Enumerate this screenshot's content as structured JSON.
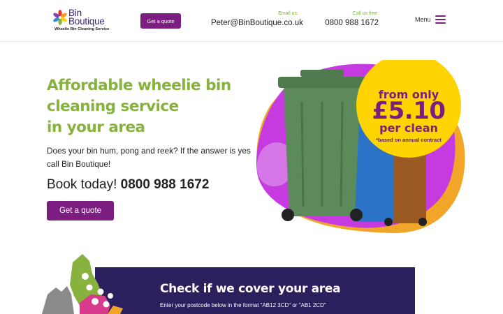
{
  "header": {
    "logo_line1": "Bin",
    "logo_line2": "Boutique",
    "logo_tagline": "Wheelie Bin Cleaning Service",
    "quote_button": "Get a quote",
    "email_label": "Email us:",
    "email_value": "Peter@BinBoutique.co.uk",
    "phone_label": "Call us free:",
    "phone_value": "0800 988 1672",
    "menu_label": "Menu"
  },
  "hero": {
    "title_lines": [
      "Affordable wheelie bin",
      "cleaning service",
      "in your area"
    ],
    "body": "Does your bin hum, pong and reek? If the answer is yes call Bin Boutique!",
    "book_prefix": "Book today!",
    "book_phone": "0800 988 1672",
    "quote_button": "Get a quote"
  },
  "promo": {
    "from": "from only",
    "price": "£5.10",
    "per": "per clean",
    "note": "*based on annual contract"
  },
  "coverage": {
    "title": "Check if we cover your area",
    "subtitle": "Enter your postcode below in the format \"AB12 3CD\" or \"AB1 2CD\""
  },
  "colors": {
    "brand_purple": "#7b1e7f",
    "brand_green": "#86b23d",
    "banner_navy": "#2b1f5e",
    "promo_yellow": "#ffd400",
    "blob_orange": "#f2a629",
    "blob_magenta": "#c63be0"
  }
}
